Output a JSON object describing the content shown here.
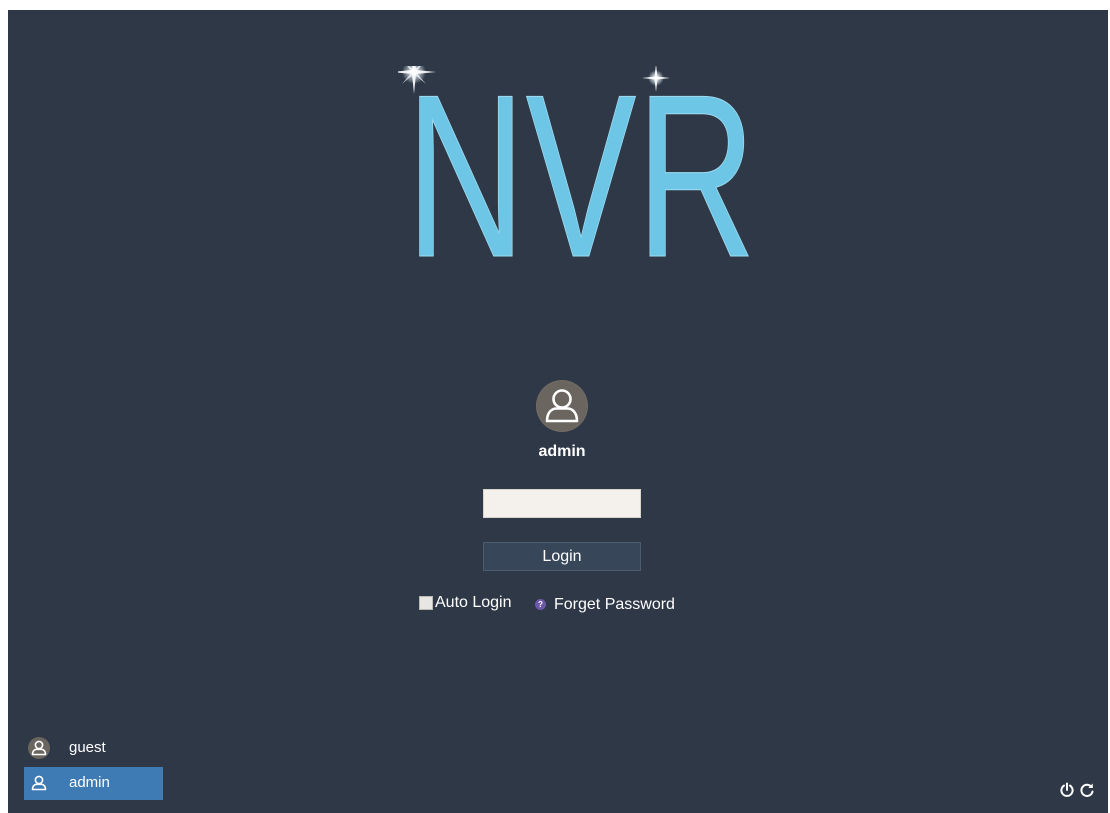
{
  "logo": {
    "text": "NVR",
    "color": "#6ec6e6"
  },
  "login": {
    "current_user": "admin",
    "password_value": "",
    "password_placeholder": "",
    "login_label": "Login",
    "auto_login_label": "Auto Login",
    "auto_login_checked": false,
    "forget_password_label": "Forget Password"
  },
  "users": [
    {
      "name": "guest",
      "selected": false
    },
    {
      "name": "admin",
      "selected": true
    }
  ],
  "icons": {
    "avatar": "user-avatar-icon",
    "forget": "help-icon",
    "power": "power-icon",
    "restart": "restart-icon"
  },
  "colors": {
    "background": "#2e3847",
    "selected_user": "#3e7bb5",
    "logo": "#6ec6e6"
  }
}
